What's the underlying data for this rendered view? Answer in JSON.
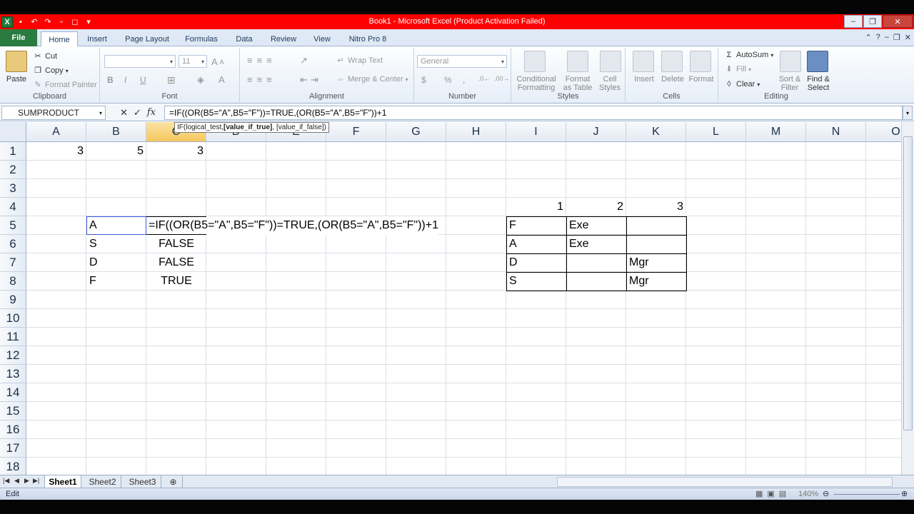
{
  "window": {
    "title": "Book1  -  Microsoft Excel (Product Activation Failed)",
    "app_icon": "X"
  },
  "tabs": [
    "File",
    "Home",
    "Insert",
    "Page Layout",
    "Formulas",
    "Data",
    "Review",
    "View",
    "Nitro Pro 8"
  ],
  "ribbon": {
    "clipboard": {
      "paste": "Paste",
      "cut": "Cut",
      "copy": "Copy",
      "format_painter": "Format Painter",
      "label": "Clipboard"
    },
    "font": {
      "size": "11",
      "bold": "B",
      "italic": "I",
      "underline": "U",
      "grow": "A",
      "label": "Font"
    },
    "alignment": {
      "wrap": "Wrap Text",
      "merge": "Merge & Center",
      "label": "Alignment"
    },
    "number": {
      "format": "General",
      "currency": "$",
      "percent": "%",
      "comma": ",",
      "label": "Number"
    },
    "styles": {
      "conditional": "Conditional",
      "conditional2": "Formatting",
      "format_table": "Format",
      "format_table2": "as Table",
      "cell_styles": "Cell",
      "cell_styles2": "Styles",
      "label": "Styles"
    },
    "cells": {
      "insert": "Insert",
      "delete": "Delete",
      "format": "Format",
      "label": "Cells"
    },
    "editing": {
      "autosum": "AutoSum",
      "fill": "Fill",
      "clear": "Clear",
      "sort": "Sort &",
      "sort2": "Filter",
      "find": "Find &",
      "find2": "Select",
      "label": "Editing"
    }
  },
  "formula_bar": {
    "name_box": "SUMPRODUCT",
    "cancel": "✕",
    "enter": "✓",
    "fx": "fx",
    "formula": "=IF((OR(B5=\"A\",B5=\"F\"))=TRUE,(OR(B5=\"A\",B5=\"F\"))+1"
  },
  "tooltip": {
    "fn": "IF(logical_test, ",
    "bold": "[value_if_true]",
    "rest": ", [value_if_false])"
  },
  "columns": [
    "A",
    "B",
    "C",
    "D",
    "E",
    "F",
    "G",
    "H",
    "I",
    "J",
    "K",
    "L",
    "M",
    "N",
    "O"
  ],
  "rows": [
    "1",
    "2",
    "3",
    "4",
    "5",
    "6",
    "7",
    "8",
    "9",
    "10",
    "11",
    "12",
    "13",
    "14",
    "15",
    "16",
    "17",
    "18"
  ],
  "cells": {
    "A1": "3",
    "B1": "5",
    "C1": "3",
    "B5": "A",
    "C5": "=IF((OR(B5=\"A\",B5=\"F\"))=TRUE,(OR(B5=\"A\",B5=\"F\"))+1",
    "B6": "S",
    "C6": "FALSE",
    "B7": "D",
    "C7": "FALSE",
    "B8": "F",
    "C8": "TRUE",
    "I4": "1",
    "J4": "2",
    "K4": "3",
    "I5": "F",
    "J5": "Exe",
    "I6": "A",
    "J6": "Exe",
    "I7": "D",
    "K7": "Mgr",
    "I8": "S",
    "K8": "Mgr"
  },
  "sheets": [
    "Sheet1",
    "Sheet2",
    "Sheet3"
  ],
  "status": {
    "mode": "Edit",
    "zoom": "140%"
  },
  "colors": {
    "title_bar": "#ff0000",
    "file_tab": "#2a7b3f",
    "selected_header": "#f6c75e"
  }
}
